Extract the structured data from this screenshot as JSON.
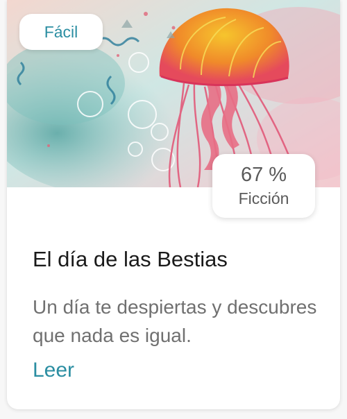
{
  "card": {
    "level_badge": "Fácil",
    "match_percent": "67 %",
    "genre": "Ficción",
    "title": "El día de las Bestias",
    "description": "Un día te despiertas y descubres que nada es igual.",
    "read_link": "Leer"
  },
  "colors": {
    "accent": "#2b8ea2",
    "title_text": "#1a1a1a",
    "body_text": "#707070"
  }
}
